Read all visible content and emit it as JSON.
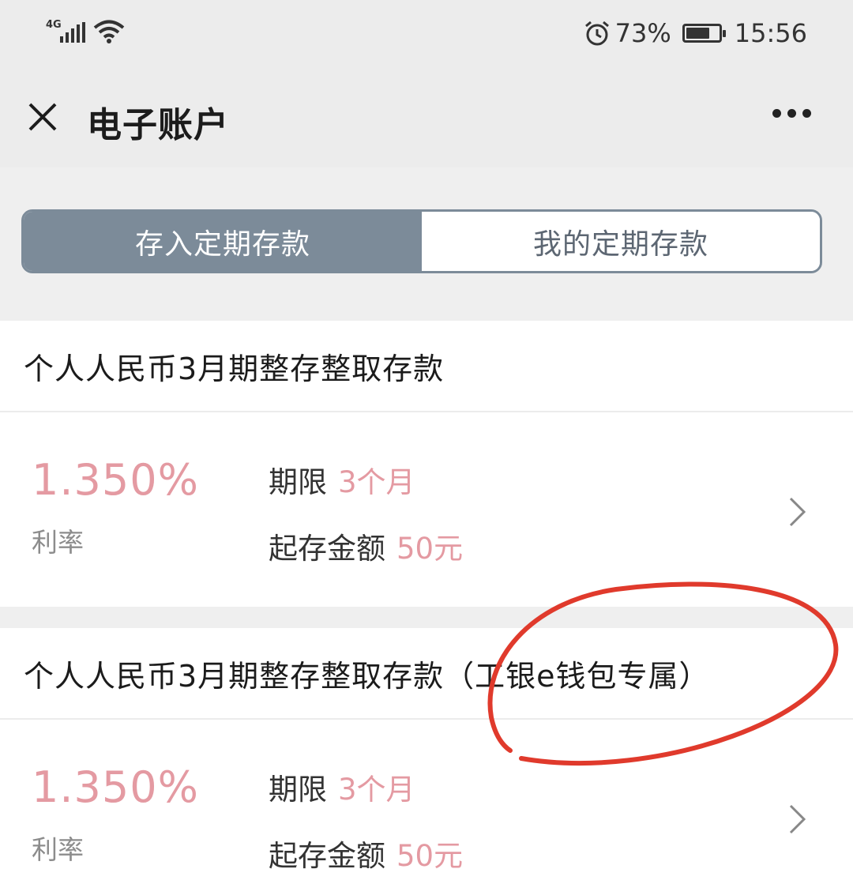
{
  "status_bar": {
    "network": "4G",
    "battery_percent": "73%",
    "battery_level": 0.73,
    "time": "15:56",
    "icons": [
      "signal-icon",
      "wifi-icon",
      "alarm-icon",
      "battery-icon"
    ]
  },
  "nav": {
    "title": "电子账户",
    "close_icon": "close-icon",
    "more_icon": "more-icon"
  },
  "tabs": [
    {
      "label": "存入定期存款",
      "active": true
    },
    {
      "label": "我的定期存款",
      "active": false
    }
  ],
  "products": [
    {
      "title": "个人人民币3月期整存整取存款",
      "rate": "1.350%",
      "rate_label": "利率",
      "term_label": "期限",
      "term_value": "3个月",
      "min_label": "起存金额",
      "min_value": "50元"
    },
    {
      "title": "个人人民币3月期整存整取存款（工银e钱包专属）",
      "rate": "1.350%",
      "rate_label": "利率",
      "term_label": "期限",
      "term_value": "3个月",
      "min_label": "起存金额",
      "min_value": "50元"
    }
  ],
  "colors": {
    "accent": "#7c8b99",
    "rate": "#e49aa2",
    "annotation": "#e03a2c"
  }
}
